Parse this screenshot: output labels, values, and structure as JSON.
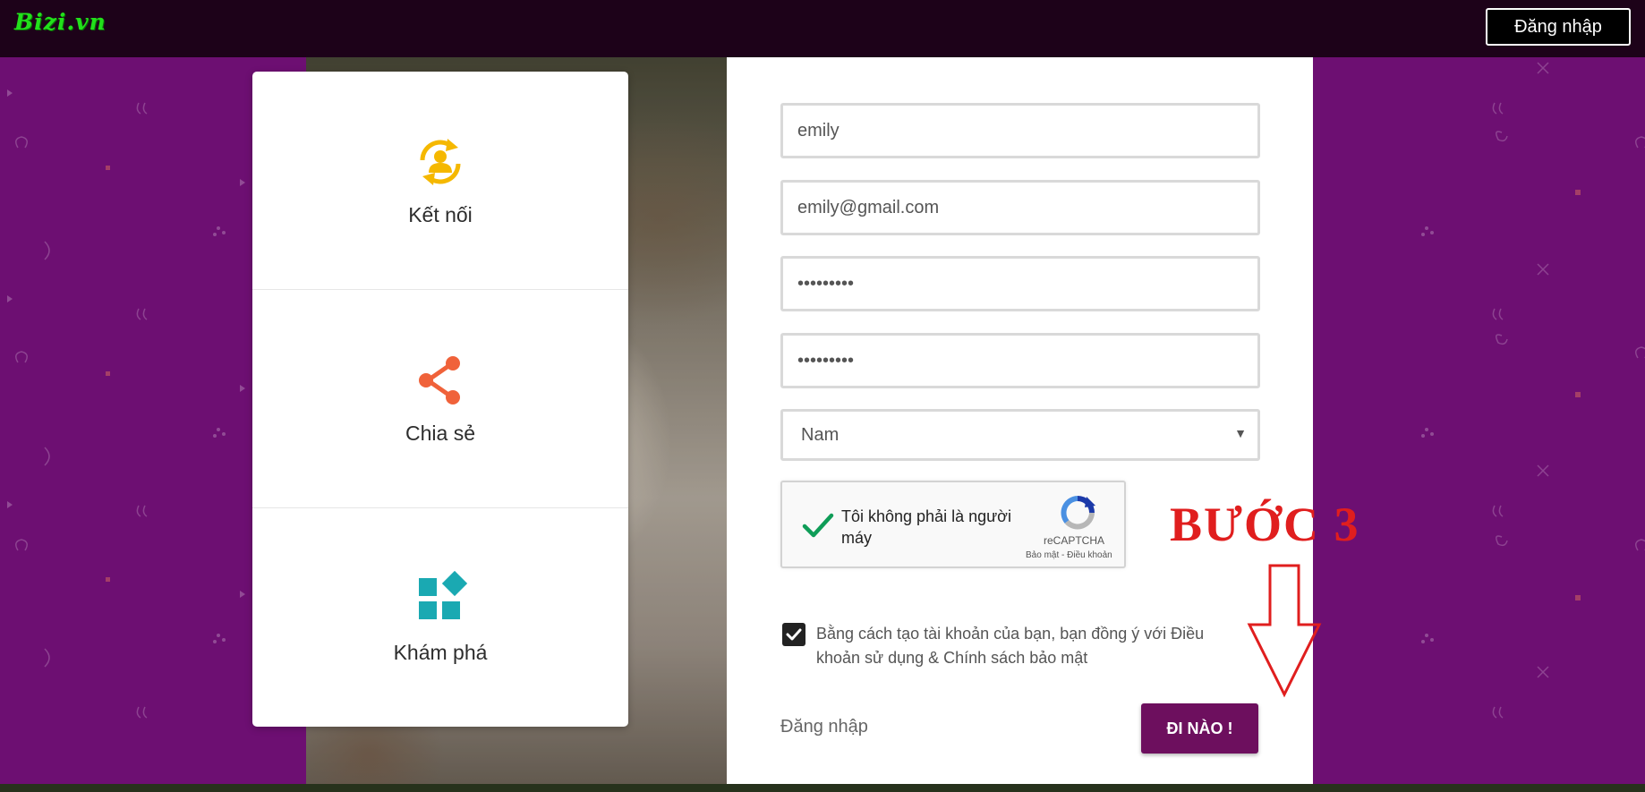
{
  "topbar": {
    "logo_text": "Bizi.vn",
    "login_label": "Đăng nhập"
  },
  "features": [
    {
      "label": "Kết nối",
      "icon": "connect-user-icon",
      "color": "#f5b800"
    },
    {
      "label": "Chia sẻ",
      "icon": "share-icon",
      "color": "#f0623a"
    },
    {
      "label": "Khám phá",
      "icon": "explore-blocks-icon",
      "color": "#1aa9b2"
    }
  ],
  "form": {
    "username_value": "emily",
    "email_value": "emily@gmail.com",
    "password_value": "•••••••••",
    "confirm_password_value": "•••••••••",
    "gender_selected": "Nam",
    "recaptcha": {
      "label": "Tôi không phải là người máy",
      "brand": "reCAPTCHA",
      "links": "Bảo mật - Điều khoản",
      "checked": true
    },
    "agree_checked": true,
    "agree_text": "Bằng cách tạo tài khoản của bạn, bạn đồng ý với Điều khoản sử dụng & Chính sách bảo mật",
    "login_link": "Đăng nhập",
    "submit_label": "ĐI NÀO !"
  },
  "annotation": {
    "step_text": "BƯỚC 3",
    "color": "#e01e1e"
  },
  "colors": {
    "background": "#6d0f72",
    "topbar": "#1d0219",
    "submit": "#6d0f5e"
  }
}
